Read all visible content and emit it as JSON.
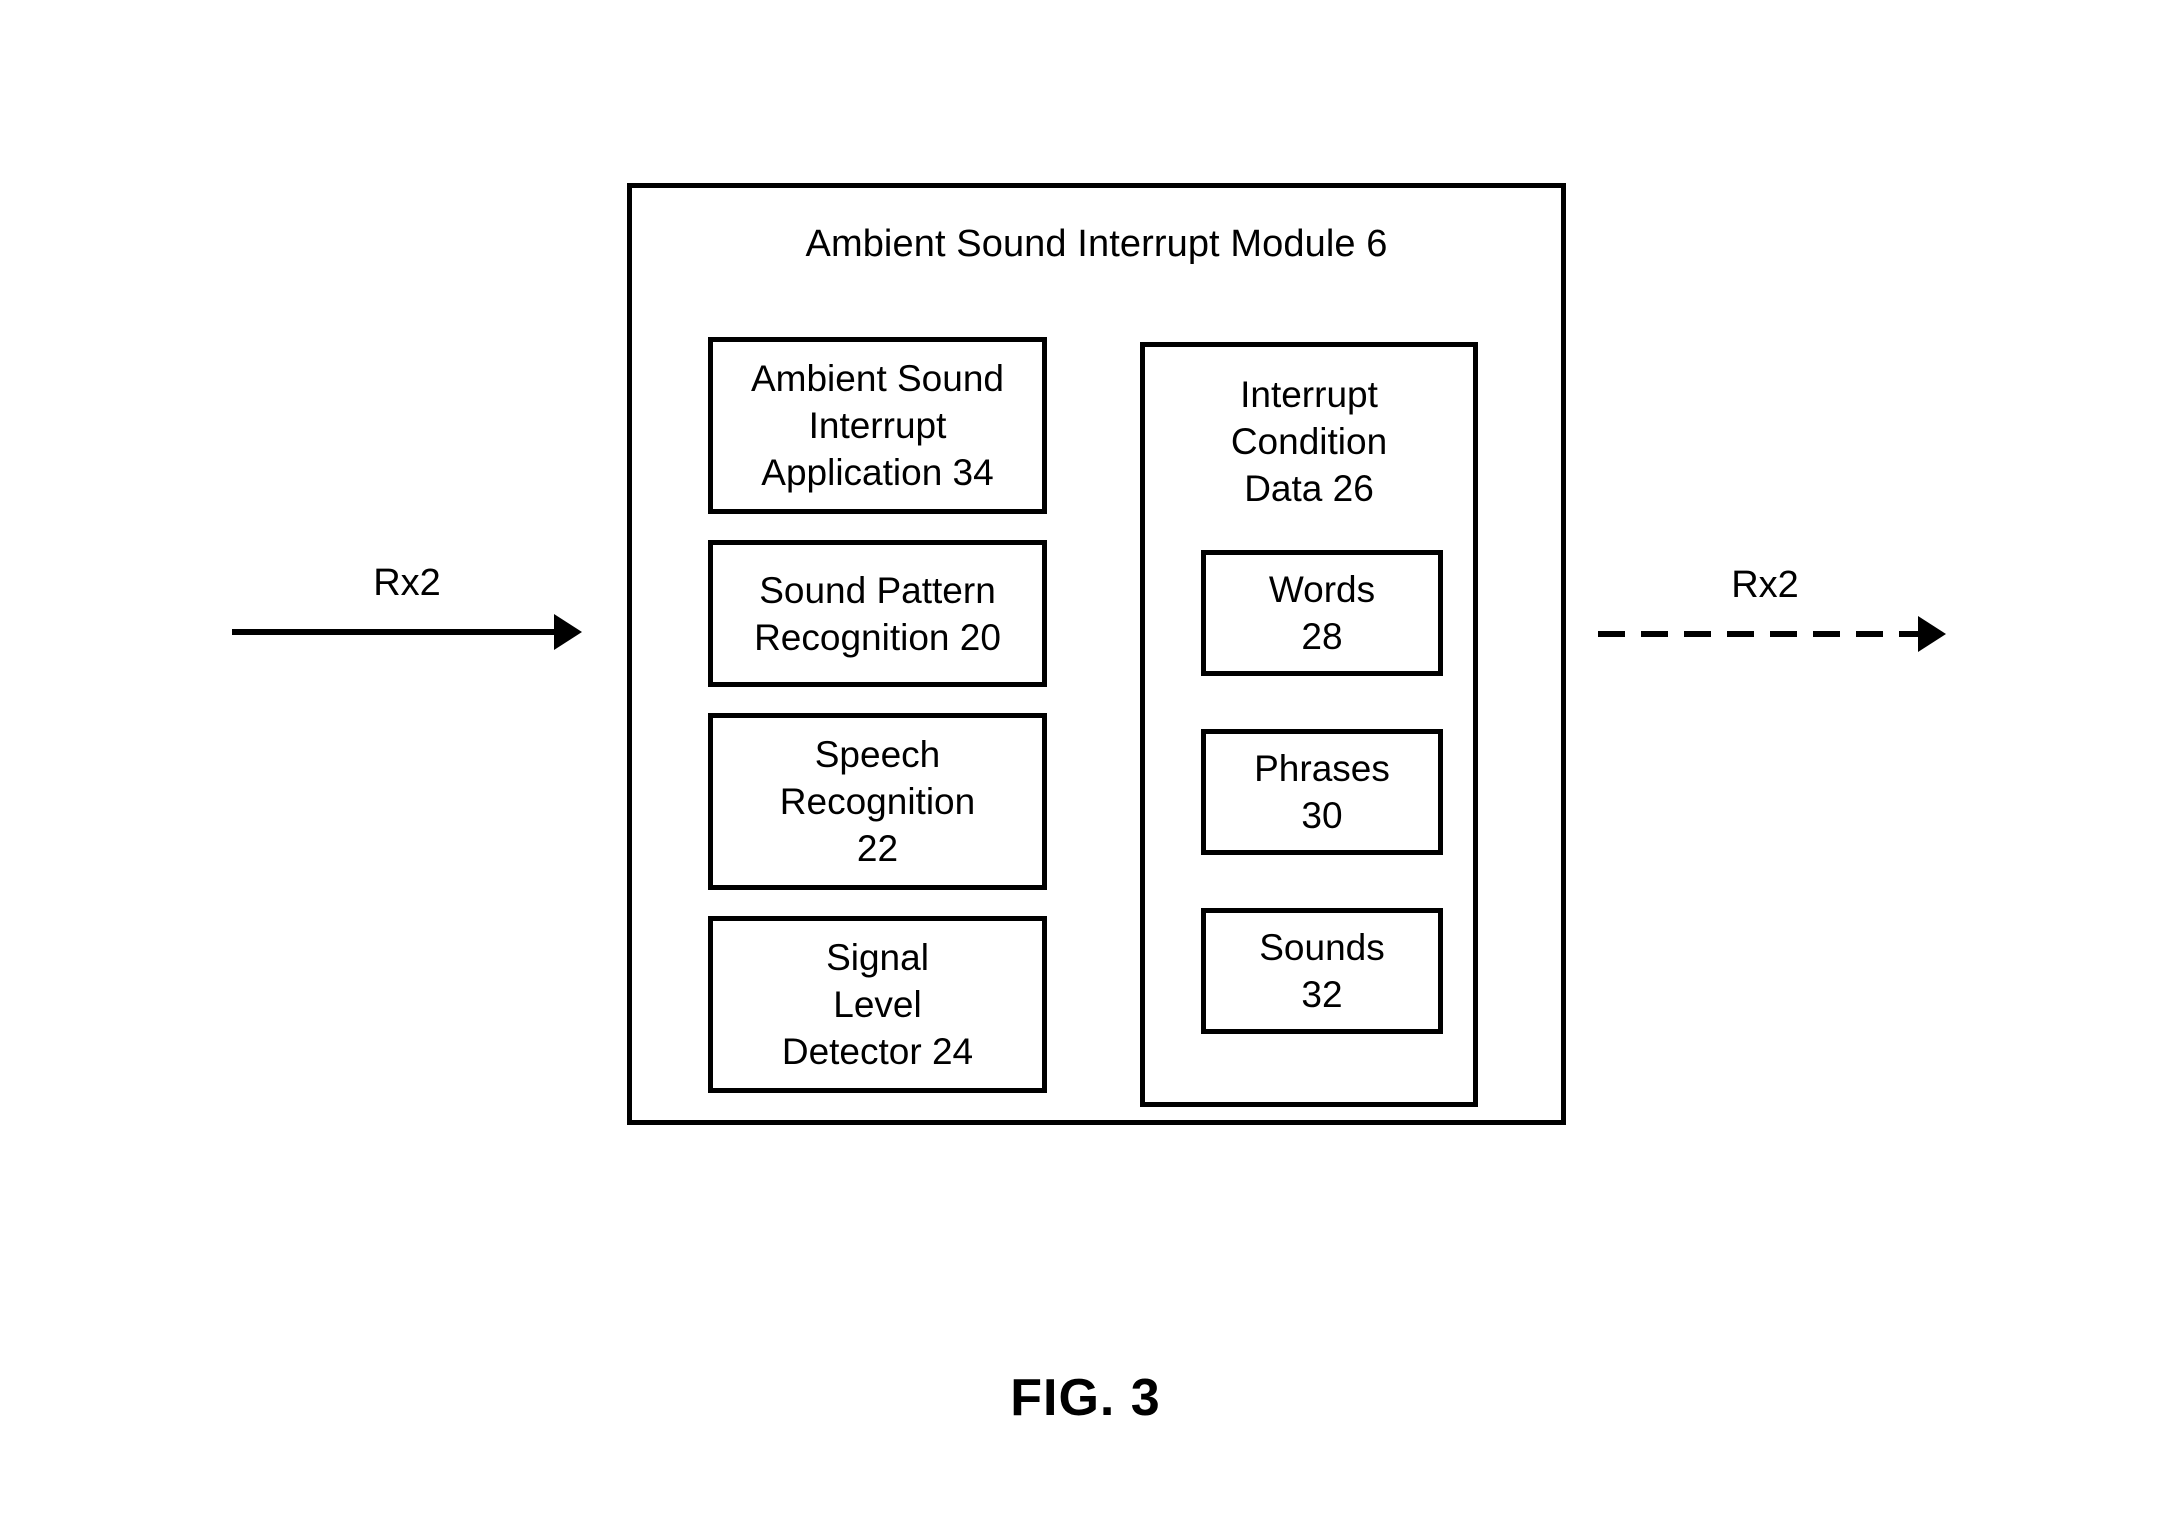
{
  "figure": {
    "caption": "FIG. 3"
  },
  "module": {
    "title": "Ambient Sound Interrupt Module 6",
    "components": [
      {
        "id": "ambient-sound-interrupt-application",
        "label": "Ambient Sound\nInterrupt\nApplication 34",
        "ref_numeral": "34"
      },
      {
        "id": "sound-pattern-recognition",
        "label": "Sound Pattern\nRecognition 20",
        "ref_numeral": "20"
      },
      {
        "id": "speech-recognition",
        "label": "Speech\nRecognition\n22",
        "ref_numeral": "22"
      },
      {
        "id": "signal-level-detector",
        "label": "Signal\nLevel\nDetector 24",
        "ref_numeral": "24"
      }
    ]
  },
  "interrupt_condition_data": {
    "title": "Interrupt\nCondition\nData 26",
    "ref_numeral": "26",
    "items": [
      {
        "id": "words",
        "label": "Words\n28",
        "ref_numeral": "28"
      },
      {
        "id": "phrases",
        "label": "Phrases\n30",
        "ref_numeral": "30"
      },
      {
        "id": "sounds",
        "label": "Sounds\n32",
        "ref_numeral": "32"
      }
    ]
  },
  "signals": {
    "input": {
      "label": "Rx2",
      "style": "solid",
      "direction": "right"
    },
    "output": {
      "label": "Rx2",
      "style": "dashed",
      "direction": "right"
    }
  },
  "colors": {
    "stroke": "#000000",
    "background": "#ffffff"
  }
}
